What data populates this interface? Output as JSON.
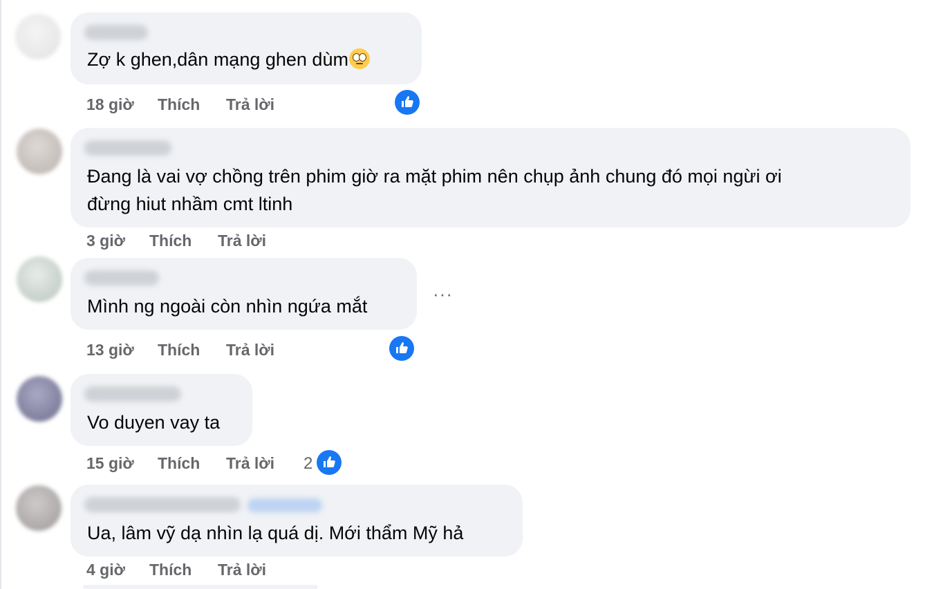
{
  "comments": [
    {
      "text": "Zợ k ghen,dân mạng ghen dùm",
      "emoji": "eye-roll-emoji",
      "time": "18 giờ",
      "like": "Thích",
      "reply": "Trả lời",
      "reaction": "like-icon",
      "reaction_count": ""
    },
    {
      "text_line1": "Đang là vai vợ chồng trên phim giờ ra mặt phim nên chụp ảnh chung đó mọi ngừi ơi",
      "text_line2": "đừng hiut nhầm cmt ltinh",
      "time": "3 giờ",
      "like": "Thích",
      "reply": "Trả lời"
    },
    {
      "text": "Mình ng ngoài còn nhìn ngứa mắt",
      "time": "13 giờ",
      "like": "Thích",
      "reply": "Trả lời",
      "reaction": "like-icon",
      "more": "···"
    },
    {
      "text": "Vo duyen vay ta",
      "time": "15 giờ",
      "like": "Thích",
      "reply": "Trả lời",
      "reaction": "like-icon",
      "reaction_count": "2"
    },
    {
      "text": "Ua, lâm vỹ dạ nhìn lạ quá dị. Mới thẩm Mỹ hả",
      "time": "4 giờ",
      "like": "Thích",
      "reply": "Trả lời"
    }
  ],
  "colors": {
    "bubble": "#f0f2f5",
    "meta": "#65676b",
    "like_blue": "#1877f2"
  }
}
